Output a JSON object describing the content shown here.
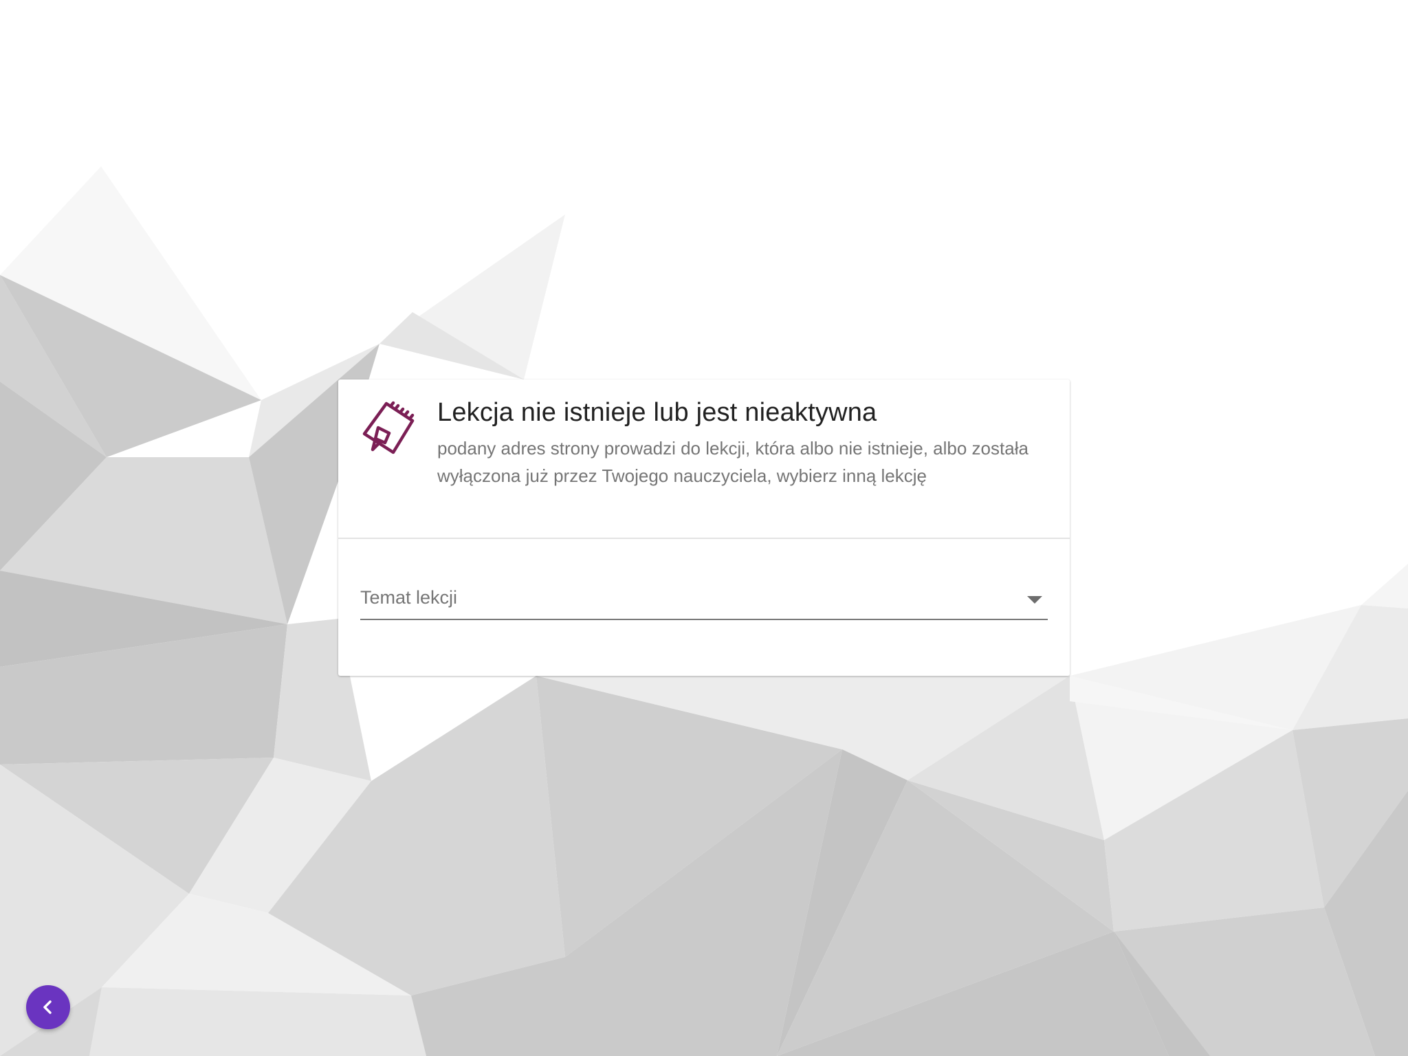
{
  "message": {
    "title": "Lekcja nie istnieje lub jest nieaktywna",
    "description": "podany adres strony prowadzi do lekcji, która albo nie istnieje, albo została wyłączona już przez Twojego nauczyciela, wybierz inną lekcję",
    "icon": "notepad-pencil-icon"
  },
  "lesson_select": {
    "label": "Temat lekcji",
    "selected_value": "",
    "icon": "dropdown-arrow-icon"
  },
  "back_button": {
    "icon": "chevron-left-icon"
  },
  "colors": {
    "accent_icon": "#7b1f55",
    "fab": "#6a34c0",
    "title_text": "#212121",
    "secondary_text": "#757575"
  }
}
